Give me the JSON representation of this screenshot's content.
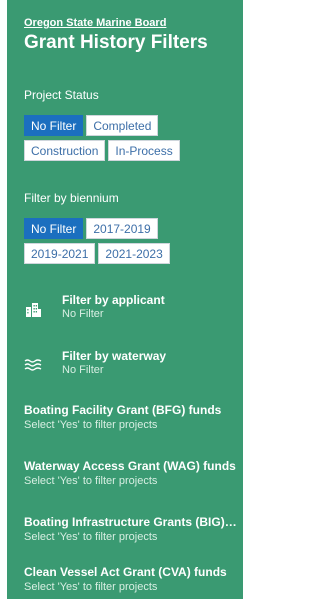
{
  "header": {
    "org_link": "Oregon State Marine Board",
    "title": "Grant History Filters"
  },
  "project_status": {
    "label": "Project Status",
    "options": [
      "No Filter",
      "Completed",
      "Construction",
      "In-Process"
    ],
    "selected": "No Filter"
  },
  "biennium": {
    "label": "Filter by biennium",
    "options": [
      "No Filter",
      "2017-2019",
      "2019-2021",
      "2021-2023"
    ],
    "selected": "No Filter"
  },
  "applicant_filter": {
    "title": "Filter by applicant",
    "value": "No Filter",
    "icon": "buildings-icon"
  },
  "waterway_filter": {
    "title": "Filter by waterway",
    "value": "No Filter",
    "icon": "waves-icon"
  },
  "funds": [
    {
      "title": "Boating Facility Grant (BFG) funds",
      "hint": "Select 'Yes' to filter projects"
    },
    {
      "title": "Waterway Access Grant (WAG) funds",
      "hint": "Select 'Yes' to filter projects"
    },
    {
      "title": "Boating Infrastructure Grants (BIG) fu…",
      "hint": "Select 'Yes' to filter projects"
    },
    {
      "title": "Clean Vessel Act Grant (CVA) funds",
      "hint": "Select 'Yes' to filter projects"
    }
  ],
  "colors": {
    "panel": "#3a9a72",
    "active_button": "#1b6fbf",
    "button_text": "#3d6fa8"
  }
}
